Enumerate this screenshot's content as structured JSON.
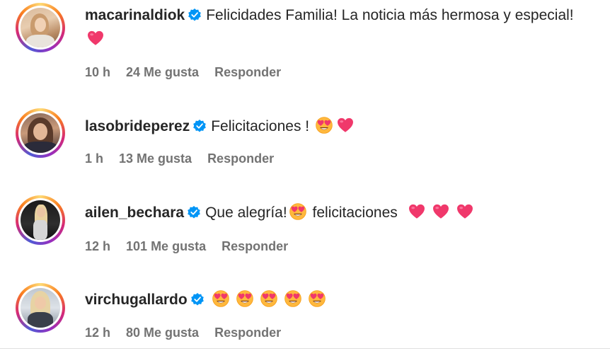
{
  "comments": [
    {
      "username": "macarinaldiok",
      "text": "Felicidades Familia! La noticia más hermosa y especial!",
      "emojis": [
        "heart"
      ],
      "time": "10 h",
      "likes": "24 Me gusta",
      "reply": "Responder"
    },
    {
      "username": "lasobrideperez",
      "text": "Felicitaciones !",
      "emojis": [
        "heart-eyes",
        "heart"
      ],
      "time": "1 h",
      "likes": "13 Me gusta",
      "reply": "Responder"
    },
    {
      "username": "ailen_bechara",
      "text_before": "Que alegría!",
      "text_after": "felicitaciones",
      "emojis": [
        "heart-eyes",
        "heart",
        "heart",
        "heart"
      ],
      "time": "12 h",
      "likes": "101 Me gusta",
      "reply": "Responder"
    },
    {
      "username": "virchugallardo",
      "text": "",
      "emojis": [
        "heart-eyes",
        "heart-eyes",
        "heart-eyes",
        "heart-eyes",
        "heart-eyes"
      ],
      "time": "12 h",
      "likes": "80 Me gusta",
      "reply": "Responder"
    }
  ],
  "colors": {
    "verified": "#0095f6",
    "heart": "#f0386b",
    "meta_text": "#737373"
  }
}
